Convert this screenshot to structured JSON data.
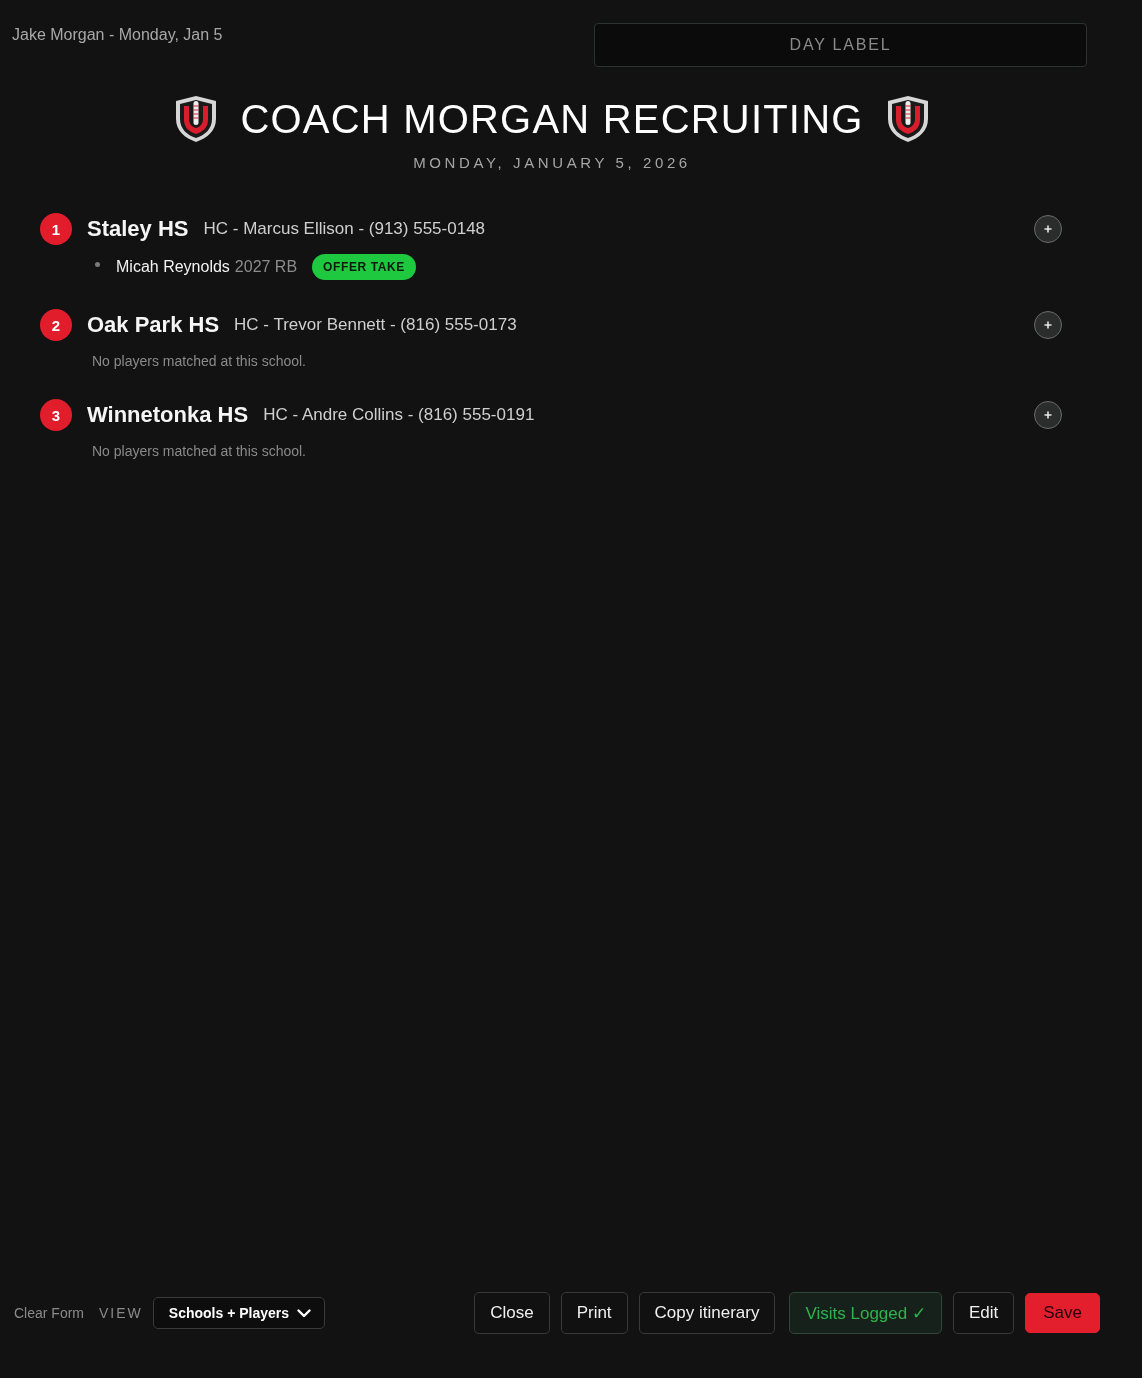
{
  "header": {
    "user_line": "Jake Morgan - Monday, Jan 5",
    "day_label": {
      "placeholder": "DAY LABEL"
    },
    "title": "COACH MORGAN RECRUITING",
    "date": "MONDAY, JANUARY 5, 2026"
  },
  "schools": [
    {
      "number": "1",
      "name": "Staley HS",
      "coach": "HC - Marcus Ellison - (913) 555-0148",
      "players": [
        {
          "name": "Micah Reynolds",
          "details": "2027 RB",
          "badge": "OFFER TAKE"
        }
      ]
    },
    {
      "number": "2",
      "name": "Oak Park HS",
      "coach": "HC - Trevor Bennett - (816) 555-0173",
      "empty_text": "No players matched at this school."
    },
    {
      "number": "3",
      "name": "Winnetonka HS",
      "coach": "HC - Andre Collins - (816) 555-0191",
      "empty_text": "No players matched at this school."
    }
  ],
  "footer": {
    "clear_form": "Clear Form",
    "view_label": "VIEW",
    "view_select": {
      "value": "Schools + Players"
    },
    "buttons": [
      {
        "label": "Close",
        "kind": "default"
      },
      {
        "label": "Print",
        "kind": "default"
      },
      {
        "label": "Copy itinerary",
        "kind": "default"
      },
      {
        "label": "Visits Logged ✓",
        "kind": "success"
      },
      {
        "label": "Edit",
        "kind": "default"
      },
      {
        "label": "Save",
        "kind": "primary"
      }
    ]
  }
}
